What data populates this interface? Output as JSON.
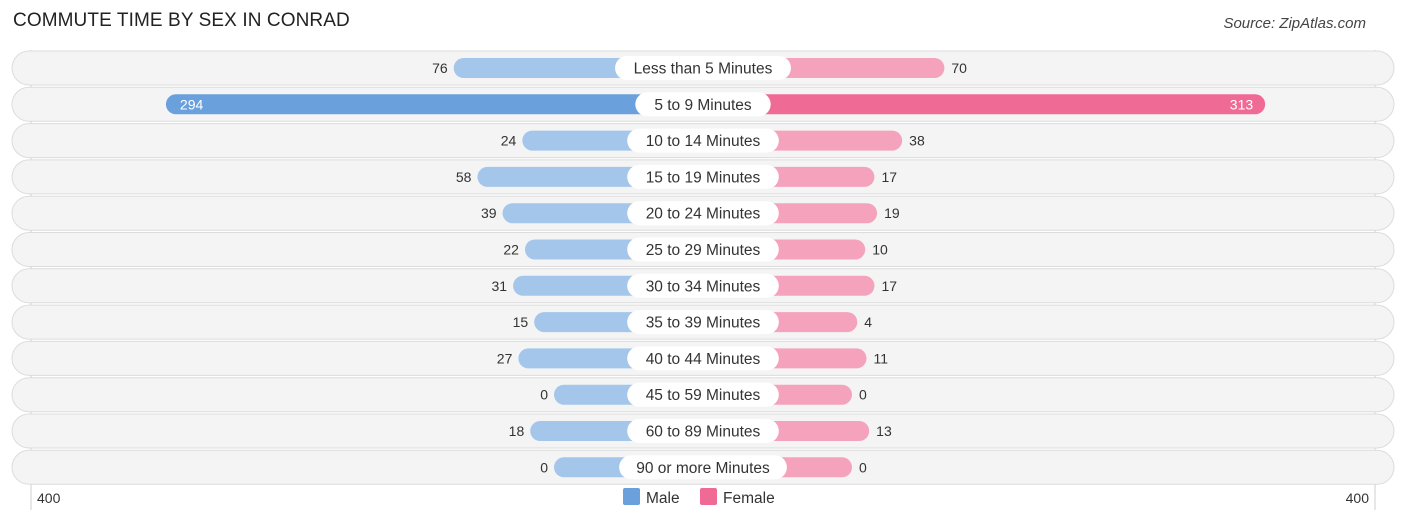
{
  "header": {
    "title": "COMMUTE TIME BY SEX IN CONRAD",
    "source": "Source: ZipAtlas.com"
  },
  "chart_data": {
    "type": "bar",
    "orientation": "horizontal-diverging",
    "title": "COMMUTE TIME BY SEX IN CONRAD",
    "categories": [
      "Less than 5 Minutes",
      "5 to 9 Minutes",
      "10 to 14 Minutes",
      "15 to 19 Minutes",
      "20 to 24 Minutes",
      "25 to 29 Minutes",
      "30 to 34 Minutes",
      "35 to 39 Minutes",
      "40 to 44 Minutes",
      "45 to 59 Minutes",
      "60 to 89 Minutes",
      "90 or more Minutes"
    ],
    "series": [
      {
        "name": "Male",
        "color": "#6aa0db",
        "light_color": "#a4c6ea",
        "side": "left",
        "values": [
          76,
          294,
          24,
          58,
          39,
          22,
          31,
          15,
          27,
          0,
          18,
          0
        ]
      },
      {
        "name": "Female",
        "color": "#f06a96",
        "light_color": "#f5a3bd",
        "side": "right",
        "values": [
          70,
          313,
          38,
          17,
          19,
          10,
          17,
          4,
          11,
          0,
          13,
          0
        ]
      }
    ],
    "axis": {
      "min_label": "400",
      "max_label": "400",
      "range": [
        -400,
        400
      ]
    },
    "legend": {
      "placement": "bottom-center",
      "entries": [
        "Male",
        "Female"
      ]
    },
    "xlabel": "",
    "ylabel": "",
    "grid": false
  }
}
